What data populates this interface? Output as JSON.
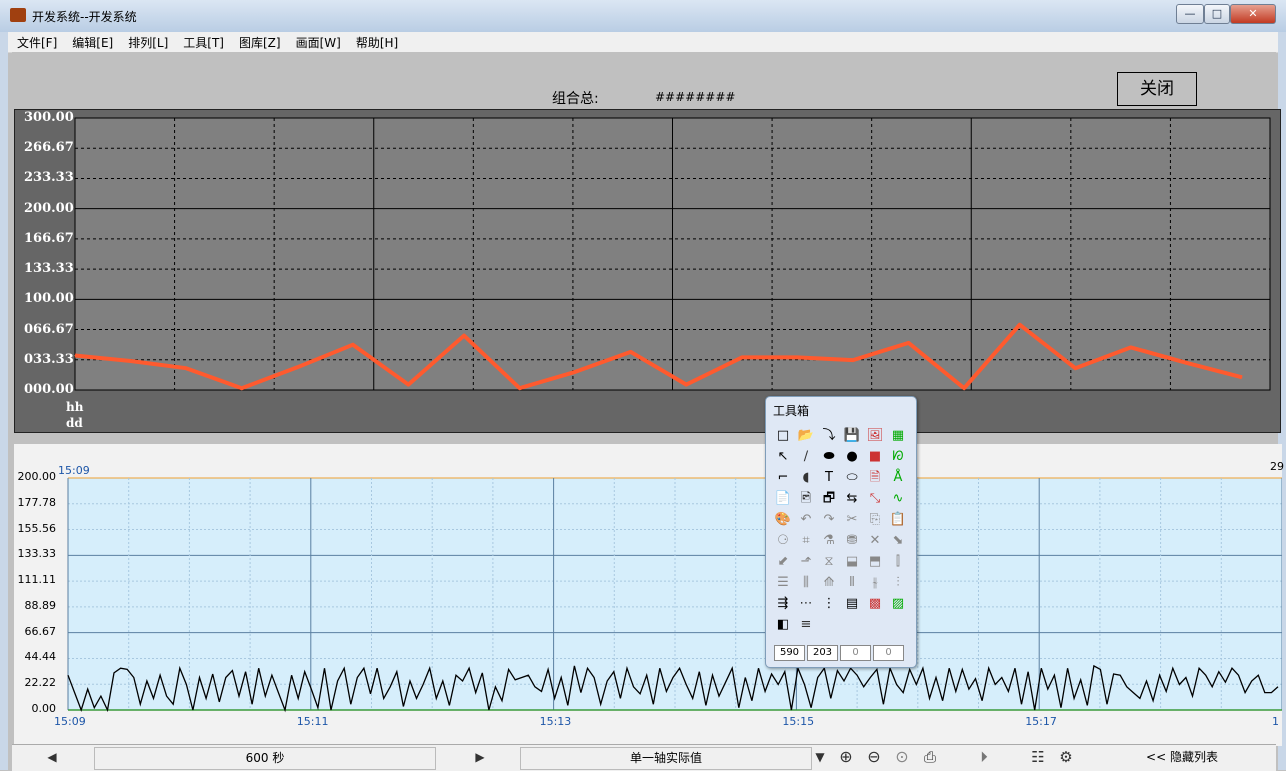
{
  "window": {
    "title": "开发系统--开发系统",
    "minimize_label": "—",
    "maximize_label": "□",
    "close_label": "✕"
  },
  "menu": [
    "文件[F]",
    "编辑[E]",
    "排列[L]",
    "工具[T]",
    "图库[Z]",
    "画面[W]",
    "帮助[H]"
  ],
  "header": {
    "group_total_label": "组合总:",
    "group_total_value": "########",
    "close_button_label": "关闭"
  },
  "chart_data": [
    {
      "type": "line",
      "ylim": [
        0,
        300
      ],
      "y_tick_labels": [
        "300.00",
        "266.67",
        "233.33",
        "200.00",
        "166.67",
        "133.33",
        "100.00",
        "066.67",
        "033.33",
        "000.00"
      ],
      "x_unit_labels": [
        "hh",
        "dd"
      ],
      "grid": true,
      "series": [
        {
          "color": "#ff5a2e",
          "values": [
            38,
            32,
            24,
            2,
            25,
            50,
            6,
            60,
            2,
            20,
            42,
            6,
            36,
            36,
            33,
            52,
            2,
            72,
            24,
            47,
            30,
            14
          ]
        }
      ]
    },
    {
      "type": "line",
      "ylim": [
        0,
        200
      ],
      "y_tick_labels": [
        "200.00",
        "177.78",
        "155.56",
        "133.33",
        "111.11",
        "88.89",
        "66.67",
        "44.44",
        "22.22",
        "0.00"
      ],
      "x_tick_labels": [
        "15:09",
        "15:11",
        "15:13",
        "15:15",
        "15:17",
        "1"
      ],
      "start_label": "15:09",
      "end_label": "29",
      "grid": true,
      "series": [
        {
          "color": "#000000",
          "values": [
            30,
            15,
            0,
            18,
            2,
            12,
            0,
            32,
            36,
            35,
            28,
            5,
            25,
            10,
            30,
            12,
            5,
            36,
            22,
            0,
            28,
            10,
            31,
            7,
            28,
            34,
            12,
            33,
            5,
            36,
            12,
            30,
            15,
            0,
            30,
            10,
            33,
            18,
            2,
            36,
            0,
            25,
            36,
            5,
            28,
            36,
            14,
            36,
            10,
            20,
            33,
            3,
            25,
            10,
            22,
            36,
            10,
            25,
            4,
            30,
            25,
            36,
            15,
            32,
            0,
            20,
            8,
            35,
            26,
            28,
            30,
            20,
            16,
            35,
            10,
            28,
            4,
            38,
            15,
            36,
            28,
            5,
            25,
            33,
            10,
            36,
            20,
            14,
            30,
            5,
            36,
            16,
            28,
            36,
            22,
            10,
            33,
            4,
            30,
            12,
            24,
            36,
            2,
            28,
            8,
            36,
            16,
            31,
            22,
            33,
            0,
            36,
            22,
            2,
            28,
            36,
            10,
            34,
            25,
            36,
            30,
            20,
            28,
            35,
            5,
            36,
            22,
            15,
            35,
            22,
            36,
            10,
            28,
            8,
            36,
            16,
            35,
            18,
            27,
            8,
            36,
            22,
            28,
            16,
            36,
            5,
            33,
            0,
            36,
            18,
            30,
            2,
            36,
            10,
            26,
            4,
            38,
            35,
            5,
            31,
            30,
            20,
            15,
            10,
            25,
            8,
            30,
            16,
            36,
            22,
            28,
            12,
            36,
            30,
            20,
            33,
            24,
            36,
            30,
            15,
            25,
            30,
            15,
            15,
            20
          ]
        }
      ]
    }
  ],
  "toolbox": {
    "title": "工具箱",
    "tools": [
      "□",
      "📂",
      "⤵",
      "💾",
      "🖼",
      "▦",
      "↖",
      "∕",
      "⬬",
      "●",
      "■",
      "ᘗ",
      "⌐",
      "◖",
      "T",
      "⬭",
      "🗎",
      "Å",
      "📄",
      "🖻",
      "🗗",
      "⇆",
      "⤡",
      "∿",
      "🎨",
      "↶",
      "↷",
      "✂",
      "⎘",
      "📋",
      "⚆",
      "⌗",
      "⚗",
      "⛃",
      "✕",
      "⬊",
      "⬋",
      "⬏",
      "⧖",
      "⬓",
      "⬒",
      "⫿",
      "☰",
      "⫼",
      "⟰",
      "⫴",
      "⫳",
      "⫶",
      "⇶",
      "⋯",
      "⋮",
      "▤",
      "▩",
      "▨",
      "◧",
      "≡"
    ],
    "fields": [
      "590",
      "203",
      "0",
      "0"
    ]
  },
  "status": {
    "speed": "600 秒",
    "mode": "单一轴实际值",
    "hide_list": "<< 隐藏列表",
    "prev_icon": "◀",
    "next_icon": "▶",
    "dropdown_icon": "▼",
    "zoom_in_icon": "⊕",
    "zoom_out_icon": "⊖",
    "zoom_reset_icon": "⊙",
    "print_icon": "⎙",
    "play_icon": "⏵",
    "list_icon": "☷",
    "settings_icon": "⚙"
  }
}
